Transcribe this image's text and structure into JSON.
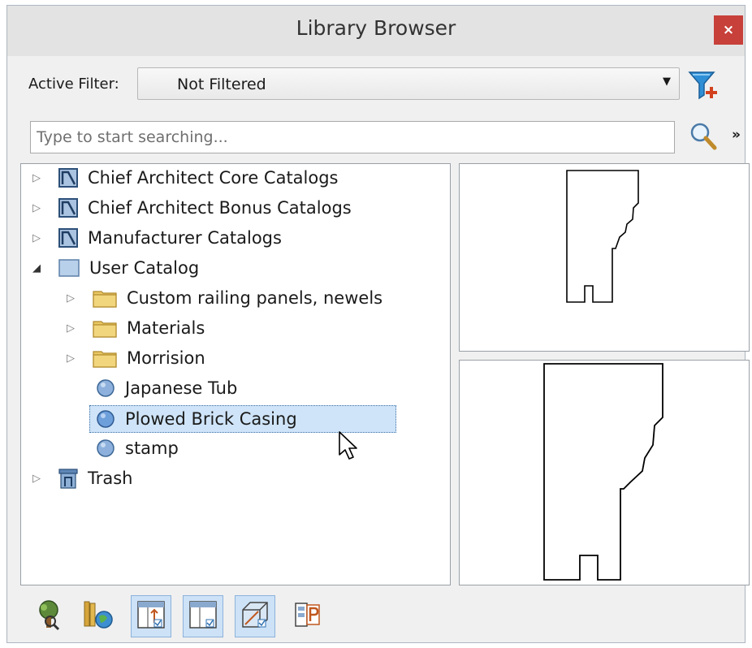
{
  "window": {
    "title": "Library Browser",
    "close_label": "×"
  },
  "filter": {
    "label": "Active Filter:",
    "value": "Not Filtered"
  },
  "search": {
    "placeholder": "Type to start searching..."
  },
  "tree": {
    "items": [
      {
        "label": "Chief Architect Core Catalogs",
        "expander": "collapsed",
        "icon": "catalog-icon"
      },
      {
        "label": "Chief Architect Bonus Catalogs",
        "expander": "collapsed",
        "icon": "catalog-icon"
      },
      {
        "label": "Manufacturer Catalogs",
        "expander": "collapsed",
        "icon": "catalog-icon"
      },
      {
        "label": "User Catalog",
        "expander": "expanded",
        "icon": "user-catalog-icon"
      },
      {
        "label": "Custom railing panels, newels",
        "expander": "collapsed",
        "icon": "folder-icon"
      },
      {
        "label": "Materials",
        "expander": "collapsed",
        "icon": "folder-icon"
      },
      {
        "label": "Morrision",
        "expander": "collapsed",
        "icon": "folder-icon"
      },
      {
        "label": "Japanese Tub",
        "expander": "none",
        "icon": "item-icon"
      },
      {
        "label": "Plowed Brick Casing",
        "expander": "none",
        "icon": "item-icon",
        "selected": true
      },
      {
        "label": "stamp",
        "expander": "none",
        "icon": "item-icon"
      },
      {
        "label": "Trash",
        "expander": "collapsed",
        "icon": "trash-icon"
      }
    ]
  },
  "toolbar": {
    "buttons": [
      {
        "icon": "tree-view-icon",
        "active": false
      },
      {
        "icon": "library-web-icon",
        "active": false
      },
      {
        "icon": "preview-top-icon",
        "active": true
      },
      {
        "icon": "preview-bottom-icon",
        "active": true
      },
      {
        "icon": "3d-preview-icon",
        "active": true
      },
      {
        "icon": "properties-icon",
        "active": false
      }
    ]
  },
  "colors": {
    "close": "#c7403a",
    "selection": "#cfe4f8",
    "folder": "#e6c35c",
    "catalog": "#9db6d6"
  }
}
